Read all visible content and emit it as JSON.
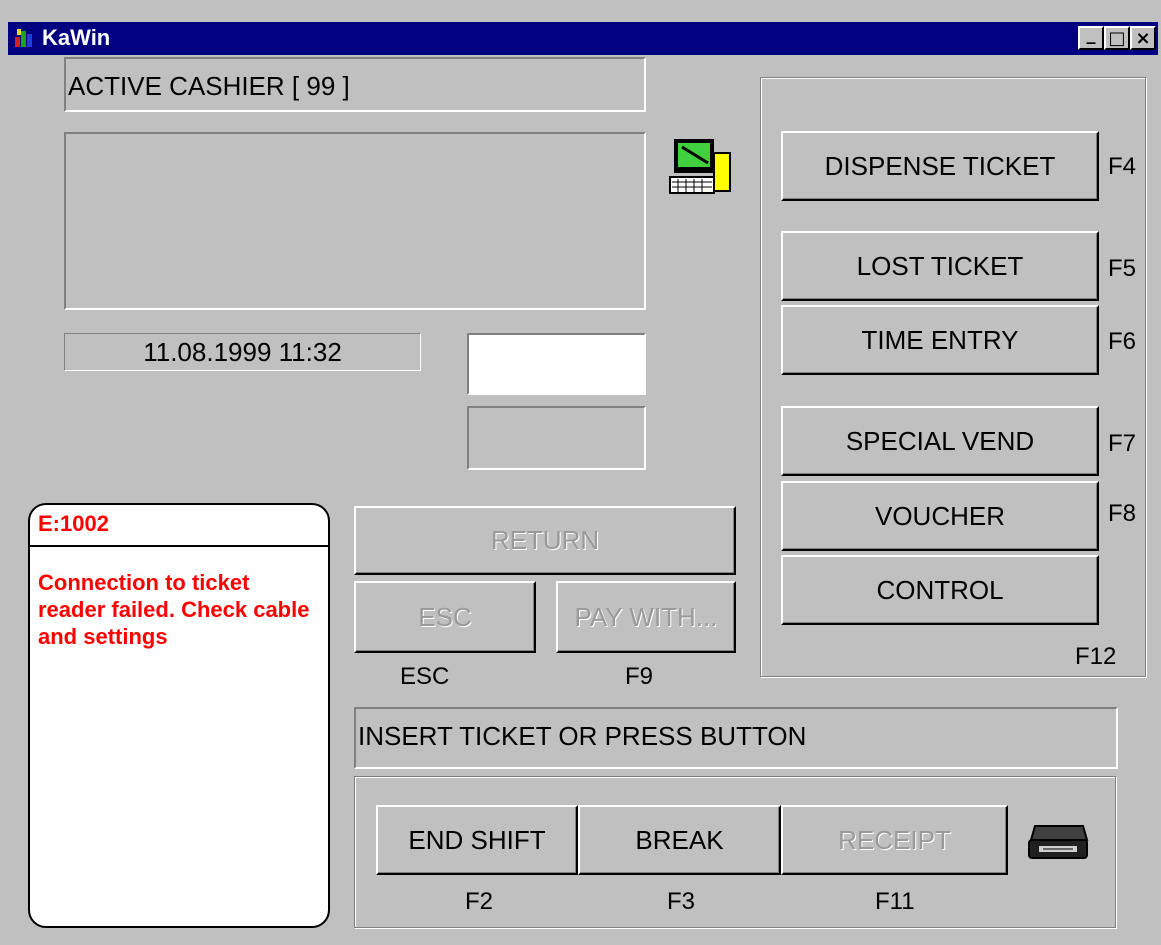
{
  "window": {
    "title": "KaWin",
    "minimize_symbol": "_",
    "maximize_symbol": "□",
    "close_symbol": "×"
  },
  "cashier": {
    "label": "ACTIVE CASHIER [ 99 ]"
  },
  "datetime": "11.08.1999 11:32",
  "error": {
    "code": "E:1002",
    "message": "Connection to ticket reader failed. Check cable and settings",
    "color": "#ff0000"
  },
  "buttons": {
    "dispense_ticket": "DISPENSE TICKET",
    "lost_ticket": "LOST TICKET",
    "time_entry": "TIME ENTRY",
    "special_vend": "SPECIAL VEND",
    "voucher": "VOUCHER",
    "control": "CONTROL",
    "return": "RETURN",
    "esc": "ESC",
    "pay_with": "PAY WITH...",
    "end_shift": "END SHIFT",
    "break": "BREAK",
    "receipt": "RECEIPT"
  },
  "keys": {
    "f4": "F4",
    "f5": "F5",
    "f6": "F6",
    "f7": "F7",
    "f8": "F8",
    "f12": "F12",
    "esc": "ESC",
    "f9": "F9",
    "f2": "F2",
    "f3": "F3",
    "f11": "F11"
  },
  "status": "INSERT TICKET OR PRESS BUTTON",
  "icons": {
    "app": "app-logo-icon",
    "terminal": "computer-terminal-icon",
    "printer": "printer-icon"
  },
  "colors": {
    "titlebar": "#000080",
    "face": "#c0c0c0",
    "error_text": "#ff0000"
  }
}
